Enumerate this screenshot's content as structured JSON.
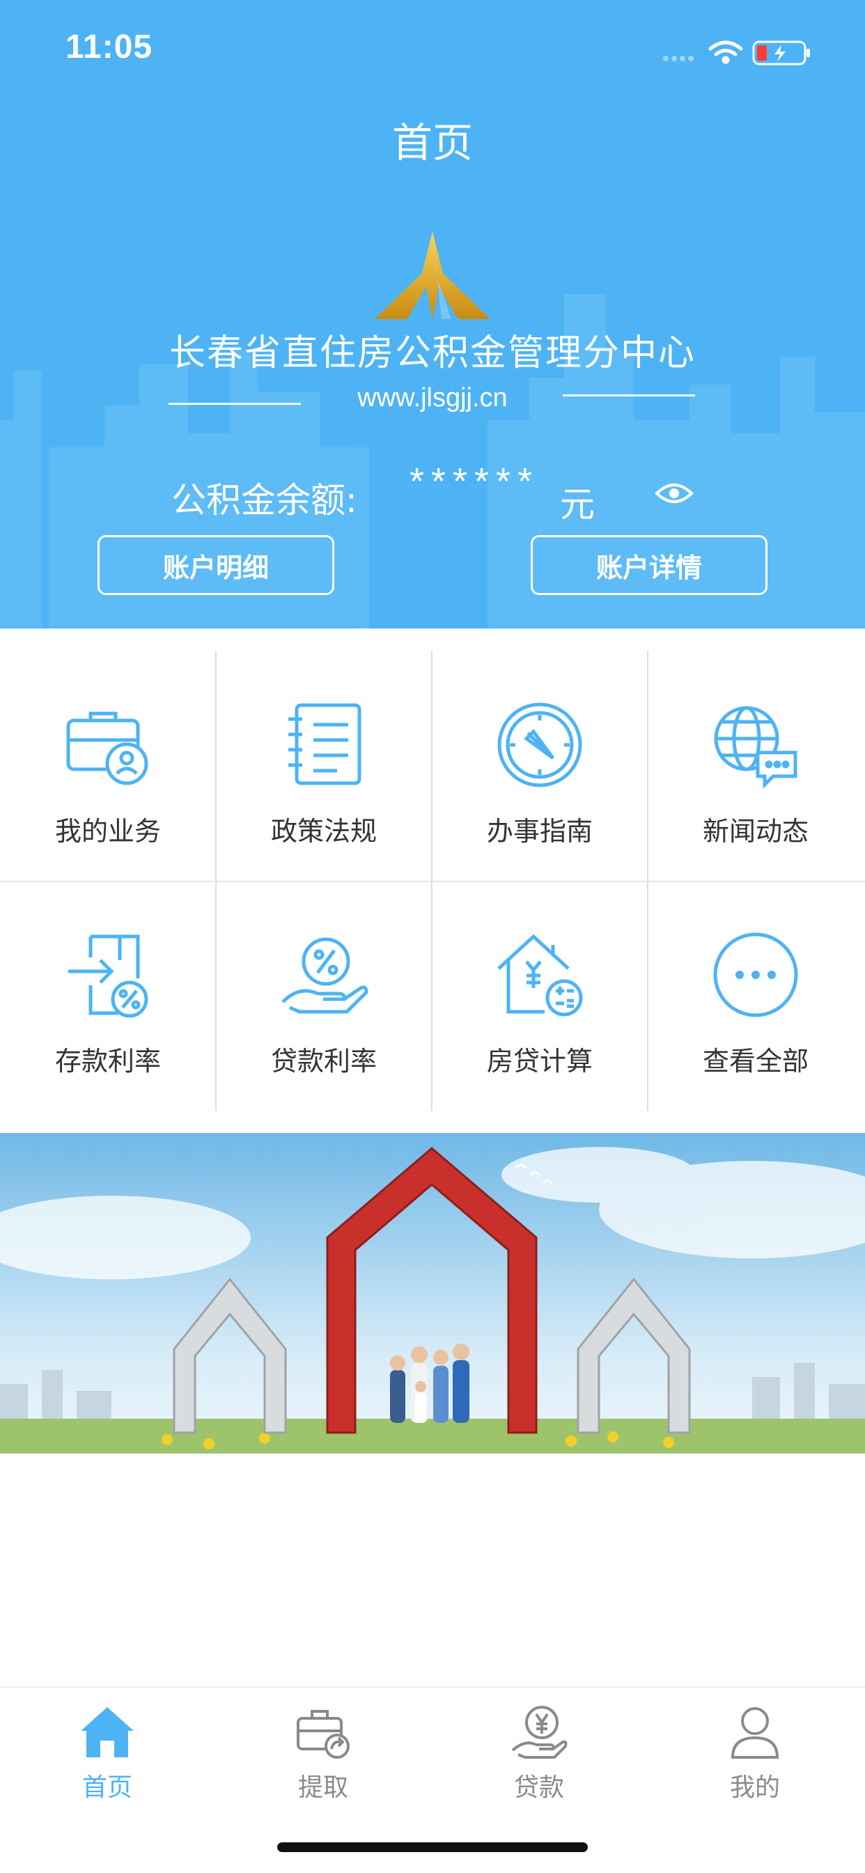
{
  "status_bar": {
    "time": "11:05",
    "battery_level": 0.2,
    "battery_charging": true
  },
  "nav": {
    "title": "首页"
  },
  "org": {
    "name": "长春省直住房公积金管理分中心",
    "url": "www.jlsgjj.cn",
    "logo_icon": "monument-logo"
  },
  "balance": {
    "label": "公积金余额:",
    "value": "******",
    "unit": "元",
    "toggle_icon": "eye-icon"
  },
  "buttons": {
    "account_detail": "账户明细",
    "account_info": "账户详情"
  },
  "grid_items": [
    {
      "label": "我的业务",
      "icon": "briefcase-user-icon"
    },
    {
      "label": "政策法规",
      "icon": "notebook-icon"
    },
    {
      "label": "办事指南",
      "icon": "compass-icon"
    },
    {
      "label": "新闻动态",
      "icon": "globe-chat-icon"
    },
    {
      "label": "存款利率",
      "icon": "deposit-rate-icon"
    },
    {
      "label": "贷款利率",
      "icon": "loan-rate-icon"
    },
    {
      "label": "房贷计算",
      "icon": "house-calculator-icon"
    },
    {
      "label": "查看全部",
      "icon": "more-icon"
    }
  ],
  "tabs": [
    {
      "label": "首页",
      "icon": "home-icon",
      "active": true
    },
    {
      "label": "提取",
      "icon": "withdraw-icon",
      "active": false
    },
    {
      "label": "贷款",
      "icon": "loan-icon",
      "active": false
    },
    {
      "label": "我的",
      "icon": "profile-icon",
      "active": false
    }
  ],
  "colors": {
    "primary": "#4db3f4",
    "tab_inactive": "#8a8a8a",
    "divider": "#dcdcdc"
  }
}
